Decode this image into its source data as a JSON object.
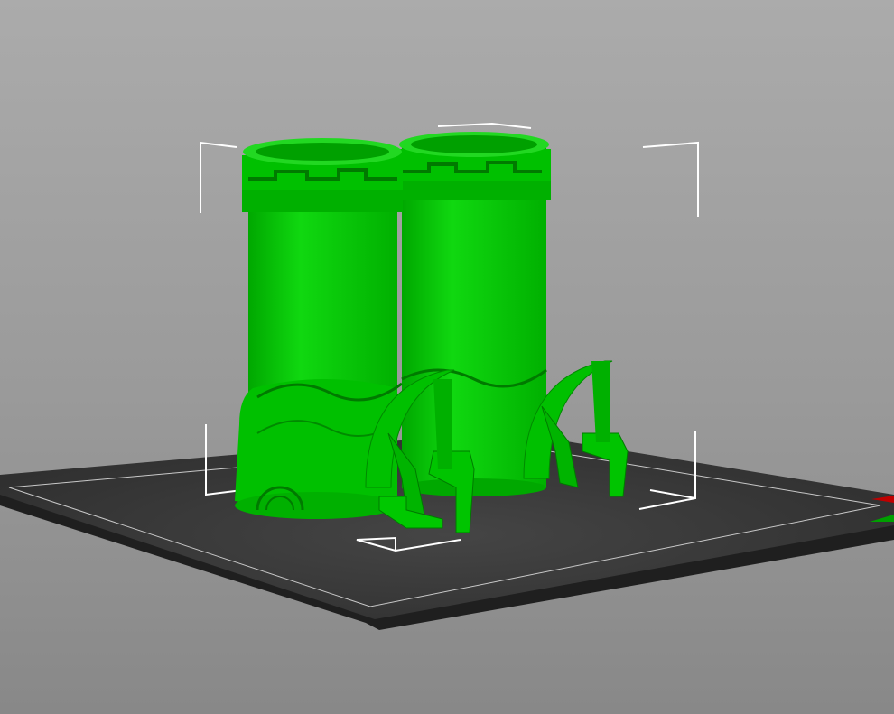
{
  "viewport": {
    "name": "3D scene",
    "colors": {
      "model": "#00c800",
      "model_shadow": "#009a00",
      "model_highlight": "#22e022",
      "bed": "#3a3a3a",
      "bed_edge": "#1e1e1e",
      "bed_outline": "#cfcfcf",
      "bounding_box": "#ffffff",
      "axis_x": "#c00000",
      "axis_y": "#00a000"
    },
    "objects": [
      {
        "name": "tower-left"
      },
      {
        "name": "tower-right"
      }
    ]
  }
}
